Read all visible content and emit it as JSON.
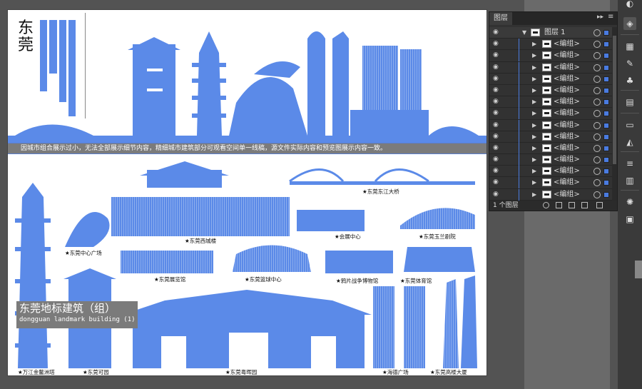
{
  "colors": {
    "accent": "#5b8ae8",
    "canvas": "#535353",
    "panel": "#323232",
    "selection": "#4a7be0"
  },
  "artboard": {
    "city_title": "东莞",
    "notice": "因城市组合展示过小，无法全部展示细节内容，精细城市建筑部分可观看空间单一线稿，源文件实际内容和预览图展示内容一致。",
    "group_title": "东莞地标建筑（组）",
    "group_subtitle": "dongguan landmark building (1)",
    "labels": {
      "dongjiang_bridge": "东莞东江大桥",
      "xicheng_tower": "东莞西城楼",
      "expo_center": "会展中心",
      "yulan_theater": "东莞玉兰剧院",
      "central_plaza": "东莞中心广场",
      "exhibition_hall": "东莞展览馆",
      "basketball_center": "东莞篮球中心",
      "opium_war_museum": "鸦片战争博物馆",
      "gymnasium": "东莞体育馆",
      "jinao_pagoda": "万江金鳌洲塔",
      "keyuan": "东莞可园",
      "yuehui_garden": "东莞粤晖园",
      "haide_plaza": "海德广场",
      "tallest_tower": "东莞高楼大厦"
    }
  },
  "layers_panel": {
    "tab_label": "图层",
    "collapse_glyph": "▸▸",
    "menu_glyph": "≡",
    "layer_name": "图层 1",
    "sublayers": [
      "<编组>",
      "<编组>",
      "<编组>",
      "<编组>",
      "<编组>",
      "<编组>",
      "<编组>",
      "<编组>",
      "<编组>",
      "<编组>",
      "<编组>",
      "<编组>",
      "<编组>",
      "<编组>"
    ],
    "footer_count": "1 个图层"
  },
  "toolbar_icons": [
    "appearance-icon",
    "layers-icon",
    "swatches-icon",
    "brushes-icon",
    "symbols-icon",
    "align-icon",
    "gradient-icon",
    "transparency-icon",
    "stroke-icon",
    "properties-icon",
    "color-icon",
    "pathfinder-icon"
  ]
}
